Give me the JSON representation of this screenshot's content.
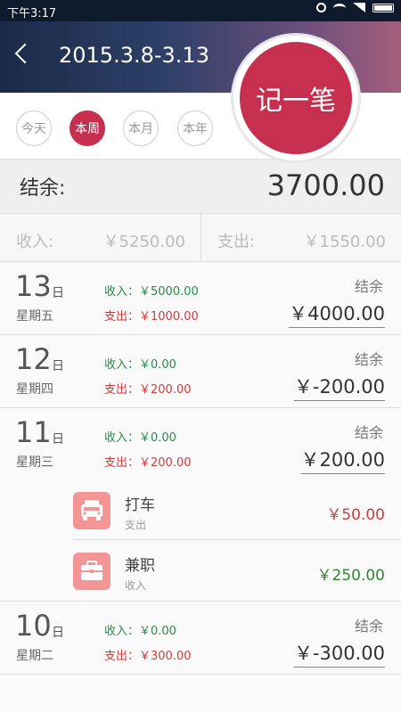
{
  "status_bar": {
    "time": "下午3:17",
    "icons": [
      "alarm-icon",
      "wifi-icon",
      "signal-icon",
      "battery-icon"
    ]
  },
  "header": {
    "date_range": "2015.3.8-3.13",
    "add_button": "记一笔"
  },
  "tabs": [
    {
      "label": "今天",
      "active": false
    },
    {
      "label": "本周",
      "active": true
    },
    {
      "label": "本月",
      "active": false
    },
    {
      "label": "本年",
      "active": false
    }
  ],
  "balance": {
    "label": "结余:",
    "value": "3700.00"
  },
  "totals": {
    "income_label": "收入:",
    "income_value": "￥5250.00",
    "expense_label": "支出:",
    "expense_value": "￥1550.00"
  },
  "days": [
    {
      "day": "13",
      "unit": "日",
      "weekday": "星期五",
      "income": "收入：￥5000.00",
      "expense": "支出：￥1000.00",
      "balance_label": "结余",
      "balance": "￥4000.00"
    },
    {
      "day": "12",
      "unit": "日",
      "weekday": "星期四",
      "income": "收入：￥0.00",
      "expense": "支出：￥200.00",
      "balance_label": "结余",
      "balance": "￥-200.00"
    },
    {
      "day": "11",
      "unit": "日",
      "weekday": "星期三",
      "income": "收入：￥0.00",
      "expense": "支出：￥200.00",
      "balance_label": "结余",
      "balance": "￥200.00"
    },
    {
      "day": "10",
      "unit": "日",
      "weekday": "星期二",
      "income": "收入：￥0.00",
      "expense": "支出：￥300.00",
      "balance_label": "结余",
      "balance": "￥-300.00"
    }
  ],
  "details": [
    {
      "title": "打车",
      "type": "支出",
      "amount": "￥50.00",
      "icon": "taxi-icon",
      "color": "#d03c3c"
    },
    {
      "title": "兼职",
      "type": "收入",
      "amount": "￥250.00",
      "icon": "briefcase-icon",
      "color": "#2a8a2a"
    }
  ],
  "colors": {
    "accent": "#c62f4e",
    "income": "#2a8a4a",
    "expense": "#d03c3c",
    "category_icon": "#f49595"
  }
}
